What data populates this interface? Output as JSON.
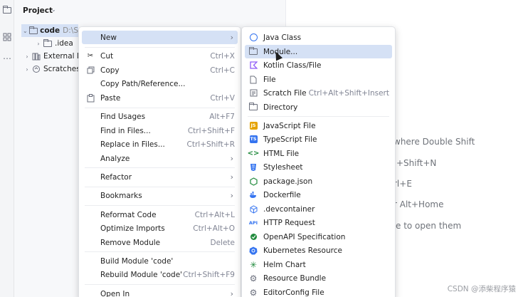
{
  "project_panel": {
    "title": "Project",
    "tree": [
      {
        "name": "code",
        "path": "D:\\S"
      },
      {
        "name": ".idea"
      },
      {
        "name": "External Li"
      },
      {
        "name": "Scratches"
      }
    ]
  },
  "editor_hints": [
    "where Double Shift",
    "+Shift+N",
    "rl+E",
    "r Alt+Home",
    "e to open them"
  ],
  "main_menu": [
    {
      "label": "New",
      "shortcut": "",
      "submenu": true
    },
    {
      "label": "Cut",
      "shortcut": "Ctrl+X"
    },
    {
      "label": "Copy",
      "shortcut": "Ctrl+C"
    },
    {
      "label": "Copy Path/Reference...",
      "shortcut": ""
    },
    {
      "label": "Paste",
      "shortcut": "Ctrl+V"
    },
    {
      "label": "Find Usages",
      "shortcut": "Alt+F7"
    },
    {
      "label": "Find in Files...",
      "shortcut": "Ctrl+Shift+F"
    },
    {
      "label": "Replace in Files...",
      "shortcut": "Ctrl+Shift+R"
    },
    {
      "label": "Analyze",
      "shortcut": "",
      "submenu": true
    },
    {
      "label": "Refactor",
      "shortcut": "",
      "submenu": true
    },
    {
      "label": "Bookmarks",
      "shortcut": "",
      "submenu": true
    },
    {
      "label": "Reformat Code",
      "shortcut": "Ctrl+Alt+L"
    },
    {
      "label": "Optimize Imports",
      "shortcut": "Ctrl+Alt+O"
    },
    {
      "label": "Remove Module",
      "shortcut": "Delete"
    },
    {
      "label": "Build Module 'code'",
      "shortcut": ""
    },
    {
      "label": "Rebuild Module 'code'",
      "shortcut": "Ctrl+Shift+F9"
    },
    {
      "label": "Open In",
      "shortcut": "",
      "submenu": true
    }
  ],
  "new_submenu": [
    {
      "label": "Java Class",
      "shortcut": ""
    },
    {
      "label": "Module...",
      "shortcut": ""
    },
    {
      "label": "Kotlin Class/File",
      "shortcut": ""
    },
    {
      "label": "File",
      "shortcut": ""
    },
    {
      "label": "Scratch File",
      "shortcut": "Ctrl+Alt+Shift+Insert"
    },
    {
      "label": "Directory",
      "shortcut": ""
    },
    {
      "label": "JavaScript File",
      "shortcut": ""
    },
    {
      "label": "TypeScript File",
      "shortcut": ""
    },
    {
      "label": "HTML File",
      "shortcut": ""
    },
    {
      "label": "Stylesheet",
      "shortcut": ""
    },
    {
      "label": "package.json",
      "shortcut": ""
    },
    {
      "label": "Dockerfile",
      "shortcut": ""
    },
    {
      "label": ".devcontainer",
      "shortcut": ""
    },
    {
      "label": "HTTP Request",
      "shortcut": ""
    },
    {
      "label": "OpenAPI Specification",
      "shortcut": ""
    },
    {
      "label": "Kubernetes Resource",
      "shortcut": ""
    },
    {
      "label": "Helm Chart",
      "shortcut": ""
    },
    {
      "label": "Resource Bundle",
      "shortcut": ""
    },
    {
      "label": "EditorConfig File",
      "shortcut": ""
    }
  ],
  "icon_badges": {
    "js": "JS",
    "ts": "TS",
    "html": "<>",
    "api": "API"
  },
  "watermark": "CSDN @添柴程序猿",
  "colors": {
    "selection": "#d5e1f5",
    "accent": "#3574f0"
  }
}
